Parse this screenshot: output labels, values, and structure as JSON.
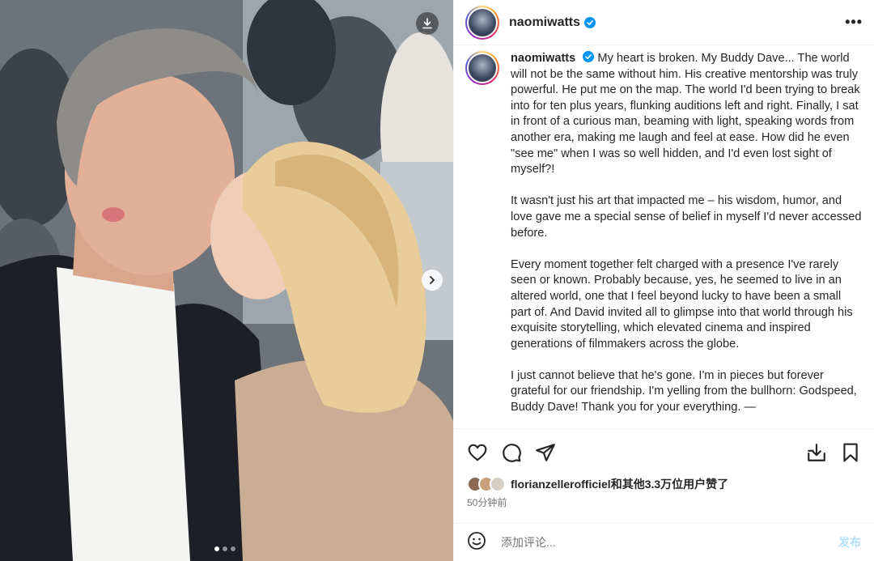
{
  "photo": {
    "download_icon": "download-icon",
    "next_icon": "chevron-right-icon",
    "carousel_dots": 3,
    "carousel_active_index": 0
  },
  "header": {
    "username": "naomiwatts",
    "verified_icon": "verified-badge-icon",
    "more_icon": "more-horizontal-icon",
    "more_label": "•••"
  },
  "caption": {
    "username": "naomiwatts",
    "paragraphs": [
      "My heart is broken. My Buddy Dave... The world will not be the same without him. His creative mentorship was truly powerful. He put me on the map. The world I'd been trying to break into for ten plus years, flunking auditions left and right. Finally, I sat in front of a curious man, beaming with light, speaking words from another era, making me laugh and feel at ease. How did he even \"see me\" when I was so well hidden, and I'd even lost sight of myself?!",
      "It wasn't just his art that impacted me – his wisdom, humor, and love gave me a special sense of belief in myself I'd never accessed before.",
      "Every moment together felt charged with a presence I've rarely seen or known. Probably because, yes, he seemed to live in an altered world, one that I feel beyond lucky to have been a small part of. And David invited all to glimpse into that world through his exquisite storytelling, which elevated cinema and inspired generations of filmmakers across the globe.",
      "I just cannot believe that he's gone. I'm in pieces but forever grateful for our friendship.  I'm yelling from the bullhorn: Godspeed, Buddy Dave! Thank you for your everything. —"
    ]
  },
  "actions": {
    "like_icon": "heart-icon",
    "comment_icon": "comment-icon",
    "share_icon": "paper-plane-icon",
    "download_icon": "save-download-icon",
    "bookmark_icon": "bookmark-icon"
  },
  "likes": {
    "text": "florianzellerofficiel和其他3.3万位用户赞了",
    "avatar_colors": [
      "#8a6a52",
      "#c9a27a",
      "#d8cfc4"
    ]
  },
  "time": "50分钟前",
  "comment": {
    "emoji_icon": "emoji-icon",
    "placeholder": "添加评论...",
    "post_label": "发布"
  },
  "colors": {
    "accent_blue": "#0095f6",
    "post_disabled": "#b2dffc",
    "text": "#262626",
    "secondary": "#737373"
  }
}
